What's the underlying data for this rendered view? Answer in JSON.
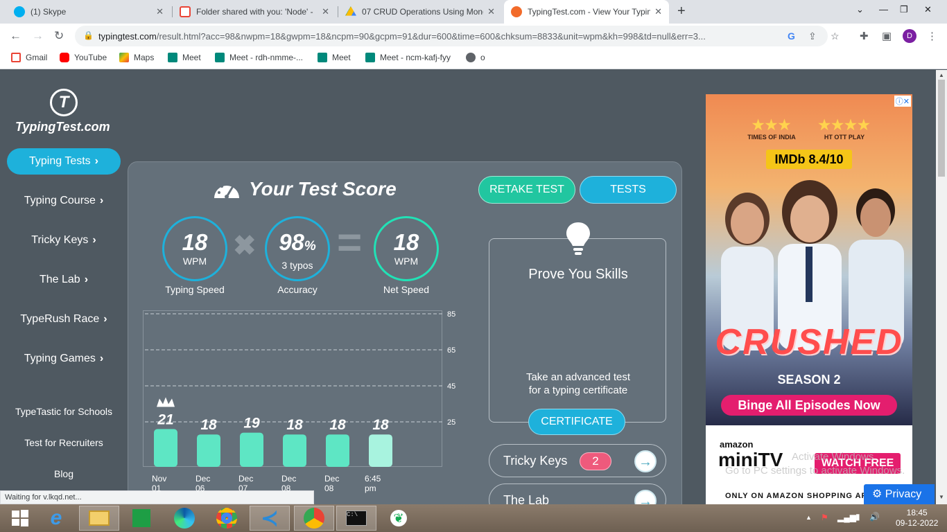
{
  "browser": {
    "tabs": [
      {
        "title": "(1) Skype",
        "favicon_color": "#00aff0"
      },
      {
        "title": "Folder shared with you: 'Node' -",
        "favicon_color": "#ea4335"
      },
      {
        "title": "07 CRUD Operations Using Mong",
        "favicon_color": "#fbbc04"
      },
      {
        "title": "TypingTest.com - View Your Typin",
        "favicon_color": "#f26b2a"
      }
    ],
    "url_host": "typingtest.com",
    "url_rest": "/result.html?acc=98&nwpm=18&gwpm=18&ncpm=90&gcpm=91&dur=600&time=600&chksum=8833&unit=wpm&kh=998&td=null&err=3...",
    "profile_initial": "D",
    "bookmarks": [
      "Gmail",
      "YouTube",
      "Maps",
      "Meet",
      "Meet - rdh-nmme-...",
      "Meet",
      "Meet - ncm-kafj-fyy",
      "o"
    ],
    "status_text": "Waiting for v.lkqd.net..."
  },
  "site": {
    "logo_mark": "T",
    "logo_text": "TypingTest.com",
    "nav": [
      "Typing Tests",
      "Typing Course",
      "Tricky Keys",
      "The Lab",
      "TypeRush Race",
      "Typing Games"
    ],
    "nav_small": [
      "TypeTastic for Schools",
      "Test for Recruiters",
      "Blog"
    ]
  },
  "score": {
    "title": "Your Test Score",
    "speed_value": "18",
    "speed_unit": "WPM",
    "speed_label": "Typing Speed",
    "accuracy_value": "98",
    "accuracy_pct": "%",
    "accuracy_sub": "3  typos",
    "accuracy_label": "Accuracy",
    "net_value": "18",
    "net_unit": "WPM",
    "net_label": "Net Speed",
    "op_times": "✖",
    "op_equals": "="
  },
  "chart_data": {
    "type": "bar",
    "categories": [
      "Nov 01",
      "Dec 06",
      "Dec 07",
      "Dec 08",
      "Dec 08",
      "6:45 pm"
    ],
    "values": [
      21,
      18,
      19,
      18,
      18,
      18
    ],
    "yticks": [
      25,
      45,
      65,
      85
    ],
    "ylim": [
      0,
      85
    ],
    "best_index": 0,
    "colors": {
      "bar": "#5ee6c4",
      "current": "#a8f3df"
    }
  },
  "actions": {
    "retake": "RETAKE TEST",
    "tests": "TESTS",
    "prove_title": "Prove You Skills",
    "prove_desc_1": "Take an advanced test",
    "prove_desc_2": "for a typing certificate",
    "certificate": "CERTIFICATE",
    "tricky_label": "Tricky Keys",
    "tricky_count": "2",
    "lab_label": "The Lab"
  },
  "ad": {
    "rating1_source": "TIMES OF INDIA",
    "rating2_source": "HT OTT PLAY",
    "imdb": "IMDb 8.4/10",
    "title": "CRUSHED",
    "season": "SEASON 2",
    "cta": "Binge All Episodes Now",
    "brand_top": "amazon",
    "brand": "miniTV",
    "watch": "WATCH FREE",
    "tagline": "ONLY ON AMAZON SHOPPING APP"
  },
  "watermark": {
    "line1": "Activate Windows",
    "line2": "Go to PC settings to activate Windows."
  },
  "privacy": "Privacy",
  "taskbar": {
    "time": "18:45",
    "date": "09-12-2022"
  }
}
